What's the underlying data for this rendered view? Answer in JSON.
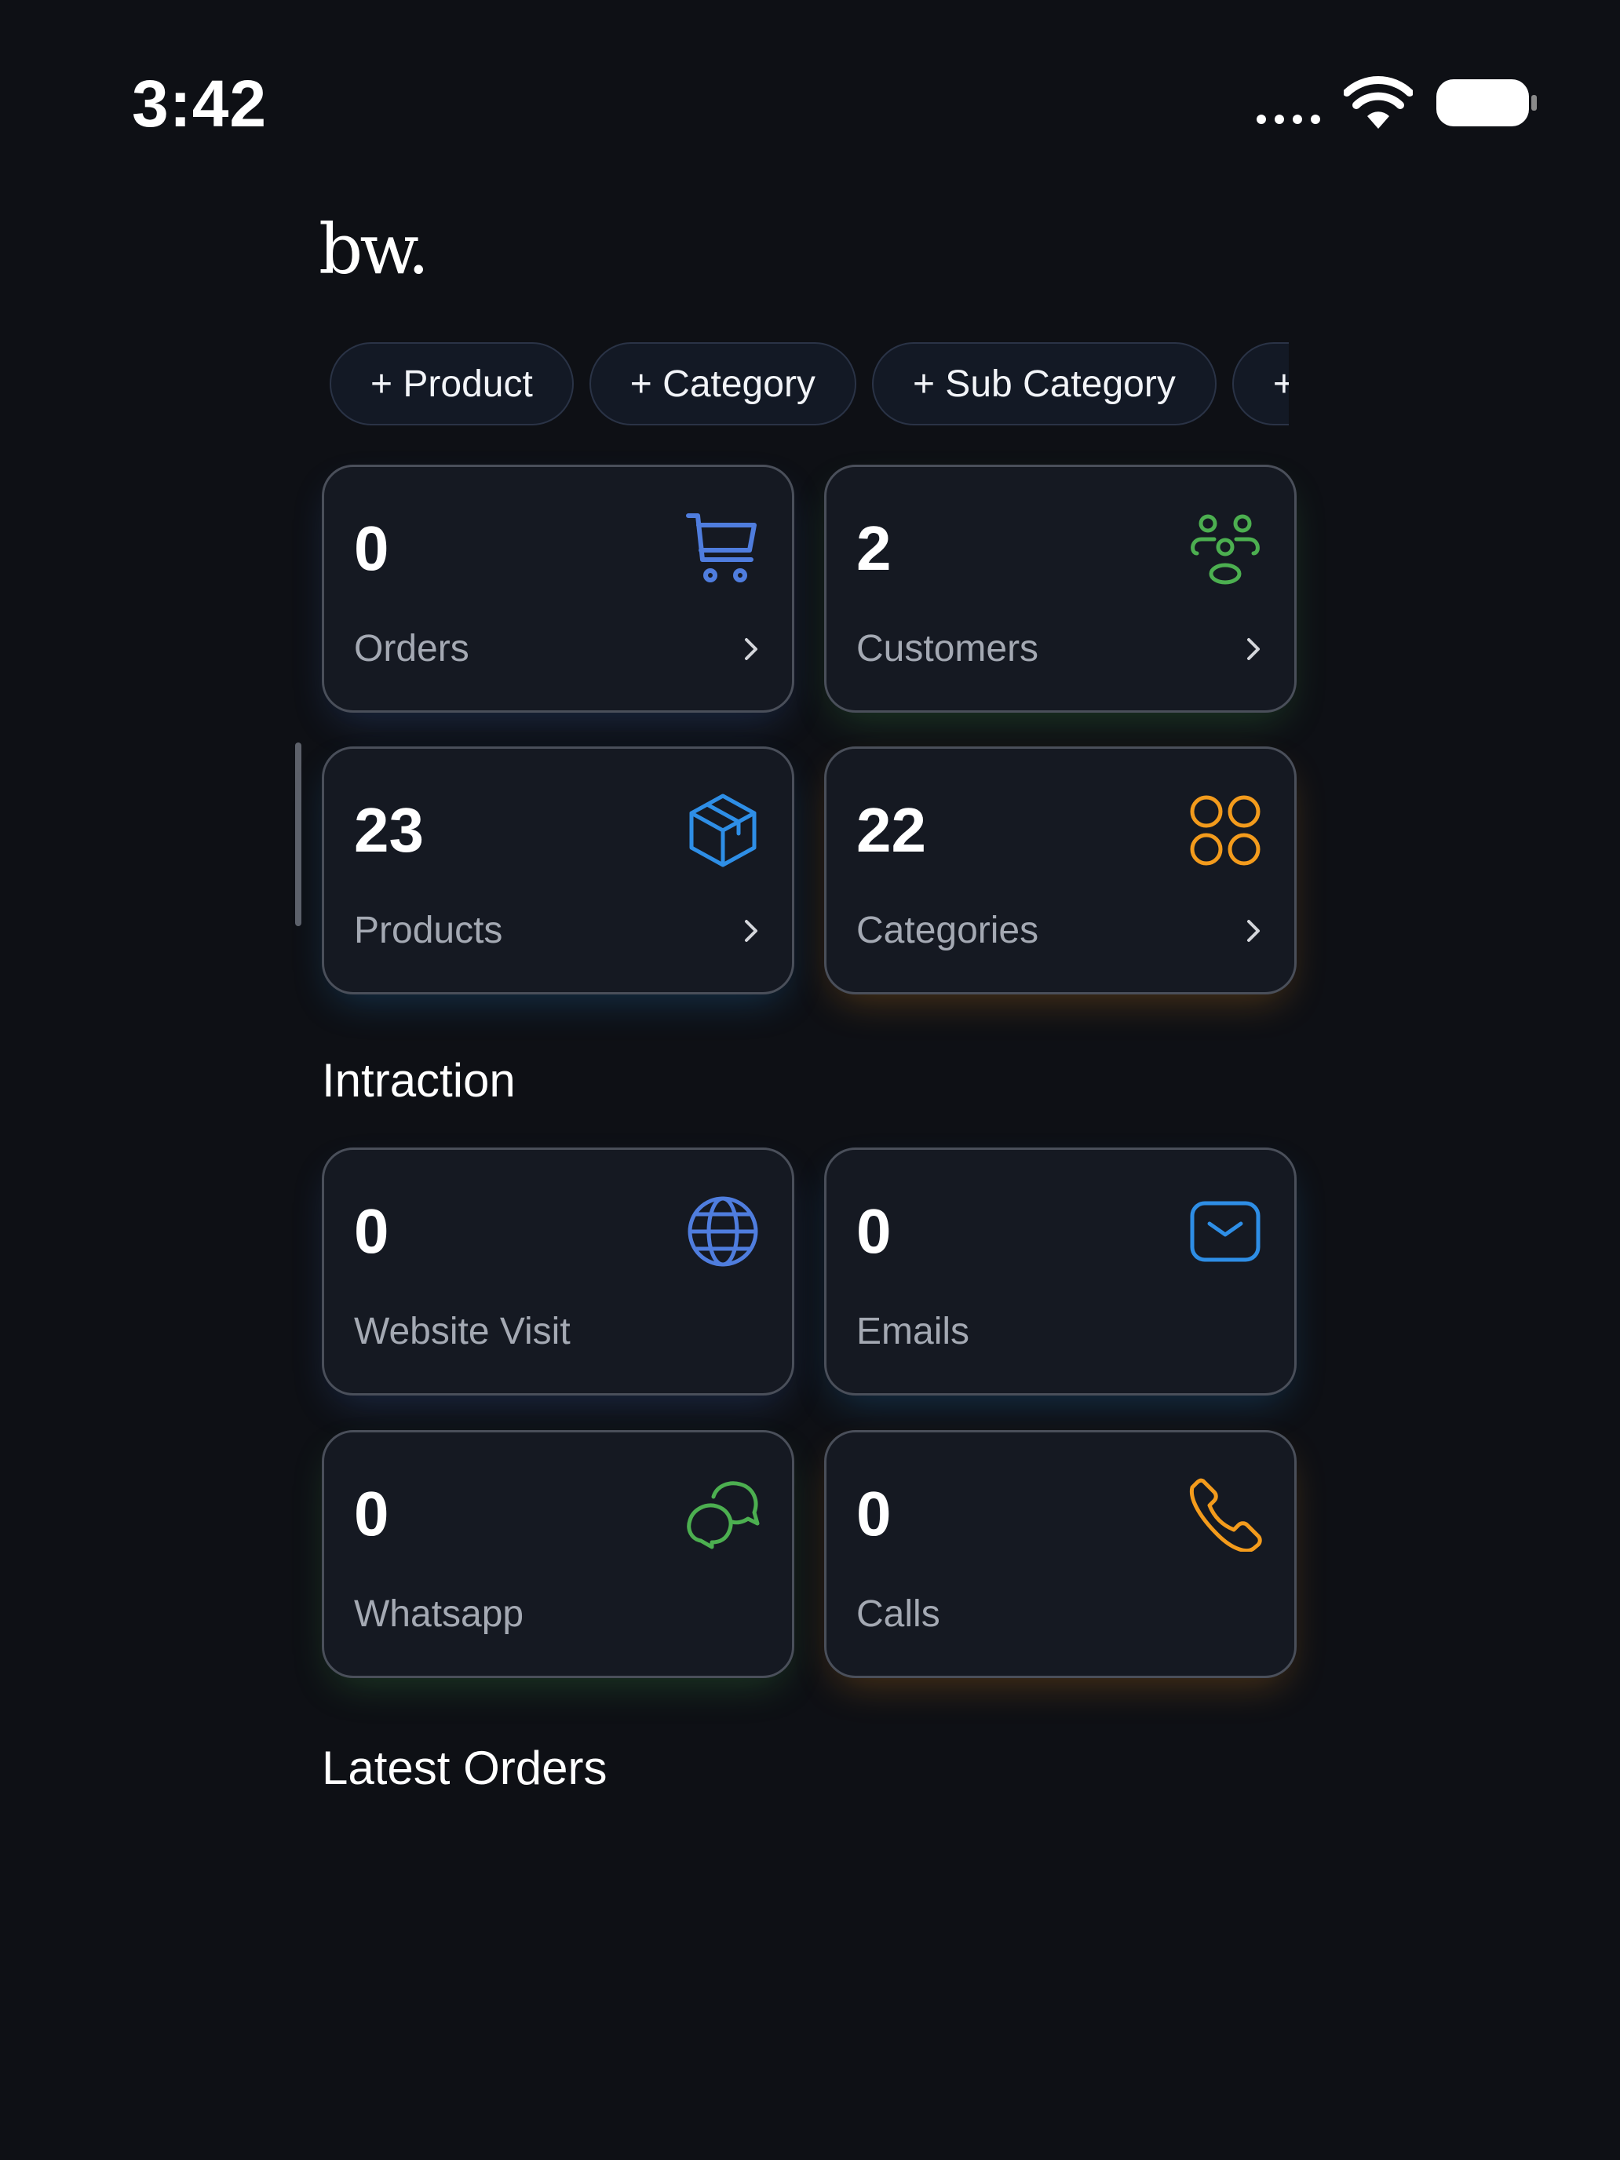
{
  "status_bar": {
    "time": "3:42"
  },
  "brand": {
    "logo": "bw."
  },
  "quick_actions": [
    {
      "label": "+ Product"
    },
    {
      "label": "+ Category"
    },
    {
      "label": "+ Sub Category"
    },
    {
      "label": "+"
    }
  ],
  "overview": {
    "orders": {
      "value": "0",
      "label": "Orders",
      "icon": "shopping-cart-icon",
      "color": "#4f7dde"
    },
    "customers": {
      "value": "2",
      "label": "Customers",
      "icon": "users-icon",
      "color": "#4caf50"
    },
    "products": {
      "value": "23",
      "label": "Products",
      "icon": "box-icon",
      "color": "#2e8ee6"
    },
    "categories": {
      "value": "22",
      "label": "Categories",
      "icon": "grid-icon",
      "color": "#f39b1c"
    }
  },
  "interaction": {
    "title": "Intraction",
    "website_visit": {
      "value": "0",
      "label": "Website Visit",
      "icon": "globe-icon",
      "color": "#4f7dde"
    },
    "emails": {
      "value": "0",
      "label": "Emails",
      "icon": "mail-icon",
      "color": "#2e8ee6"
    },
    "whatsapp": {
      "value": "0",
      "label": "Whatsapp",
      "icon": "chat-icon",
      "color": "#4caf50"
    },
    "calls": {
      "value": "0",
      "label": "Calls",
      "icon": "phone-icon",
      "color": "#f39b1c"
    }
  },
  "latest_orders": {
    "title": "Latest Orders"
  }
}
